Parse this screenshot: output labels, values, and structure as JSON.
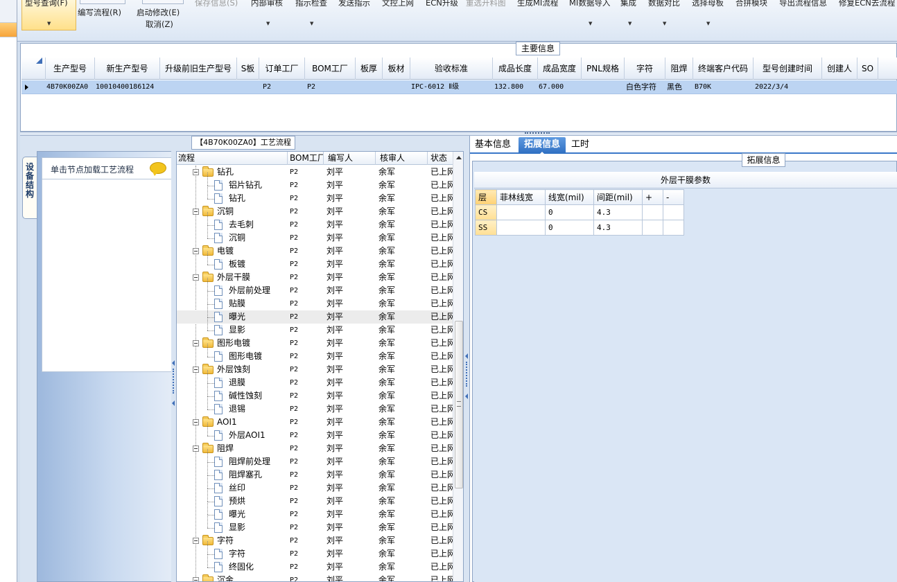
{
  "ribbon": {
    "query_model": "型号查询(F)",
    "write_flow": "编写流程(R)",
    "start_modify": "启动修改(E)",
    "cancel": "取消(Z)",
    "save_info": "保存信息(S)",
    "internal_review": "内部审核",
    "instruction_check": "指示检查",
    "send_instruction": "发送指示",
    "doc_upload": "文控上网",
    "ecn_upgrade": "ECN升级",
    "reselect_cutting": "重选开料图",
    "gen_mi_flow": "生成MI流程",
    "mi_data_import": "MI数据导入",
    "integrate": "集成",
    "data_compare": "数据对比",
    "select_mother": "选择母板",
    "merge_module": "合拼模块",
    "export_flow": "导出流程信息",
    "repair_ecn": "修复ECN去流程"
  },
  "main_info": {
    "title": "主要信息",
    "columns": [
      "生产型号",
      "新生产型号",
      "升级前旧生产型号",
      "S板",
      "订单工厂",
      "BOM工厂",
      "板厚",
      "板材",
      "验收标准",
      "成品长度",
      "成品宽度",
      "PNL规格",
      "字符",
      "阻焊",
      "终端客户代码",
      "型号创建时间",
      "创建人",
      "SO"
    ],
    "row": {
      "prod_model": "4B70K00ZA0",
      "new_model": "10010400186124",
      "old_model": "",
      "s_board": "",
      "order_factory": "P2",
      "bom_factory": "P2",
      "thickness": "",
      "material": "",
      "standard": "IPC-6012 Ⅱ级",
      "length": "132.800",
      "width": "67.000",
      "pnl": "",
      "character": "白色字符",
      "solder_mask": "黑色",
      "customer_code": "B70K",
      "created": "2022/3/4",
      "creator": "",
      "so": ""
    }
  },
  "process": {
    "title": "【4B70K00ZA0】工艺流程",
    "side_tab": "设备结构",
    "equip_hint": "单击节点加载工艺流程",
    "columns": [
      "流程",
      "BOM工厂",
      "编写人",
      "核审人",
      "状态"
    ],
    "rows": [
      {
        "name": "钻孔",
        "type": "folder",
        "bom": "P2",
        "writer": "刘平",
        "reviewer": "余军",
        "status": "已上网"
      },
      {
        "name": "铝片钻孔",
        "type": "leaf",
        "bom": "P2",
        "writer": "刘平",
        "reviewer": "余军",
        "status": "已上网"
      },
      {
        "name": "钻孔",
        "type": "leaf",
        "bom": "P2",
        "writer": "刘平",
        "reviewer": "余军",
        "status": "已上网"
      },
      {
        "name": "沉铜",
        "type": "folder",
        "bom": "P2",
        "writer": "刘平",
        "reviewer": "余军",
        "status": "已上网"
      },
      {
        "name": "去毛刺",
        "type": "leaf",
        "bom": "P2",
        "writer": "刘平",
        "reviewer": "余军",
        "status": "已上网"
      },
      {
        "name": "沉铜",
        "type": "leaf",
        "bom": "P2",
        "writer": "刘平",
        "reviewer": "余军",
        "status": "已上网"
      },
      {
        "name": "电镀",
        "type": "folder",
        "bom": "P2",
        "writer": "刘平",
        "reviewer": "余军",
        "status": "已上网"
      },
      {
        "name": "板镀",
        "type": "leaf",
        "bom": "P2",
        "writer": "刘平",
        "reviewer": "余军",
        "status": "已上网"
      },
      {
        "name": "外层干膜",
        "type": "folder",
        "bom": "P2",
        "writer": "刘平",
        "reviewer": "余军",
        "status": "已上网"
      },
      {
        "name": "外层前处理",
        "type": "leaf",
        "bom": "P2",
        "writer": "刘平",
        "reviewer": "余军",
        "status": "已上网"
      },
      {
        "name": "贴膜",
        "type": "leaf",
        "bom": "P2",
        "writer": "刘平",
        "reviewer": "余军",
        "status": "已上网"
      },
      {
        "name": "曝光",
        "type": "leaf",
        "bom": "P2",
        "writer": "刘平",
        "reviewer": "余军",
        "status": "已上网",
        "selected": true
      },
      {
        "name": "显影",
        "type": "leaf",
        "bom": "P2",
        "writer": "刘平",
        "reviewer": "余军",
        "status": "已上网"
      },
      {
        "name": "图形电镀",
        "type": "folder",
        "bom": "P2",
        "writer": "刘平",
        "reviewer": "余军",
        "status": "已上网"
      },
      {
        "name": "图形电镀",
        "type": "leaf",
        "bom": "P2",
        "writer": "刘平",
        "reviewer": "余军",
        "status": "已上网"
      },
      {
        "name": "外层蚀刻",
        "type": "folder",
        "bom": "P2",
        "writer": "刘平",
        "reviewer": "余军",
        "status": "已上网"
      },
      {
        "name": "退膜",
        "type": "leaf",
        "bom": "P2",
        "writer": "刘平",
        "reviewer": "余军",
        "status": "已上网"
      },
      {
        "name": "碱性蚀刻",
        "type": "leaf",
        "bom": "P2",
        "writer": "刘平",
        "reviewer": "余军",
        "status": "已上网"
      },
      {
        "name": "退锡",
        "type": "leaf",
        "bom": "P2",
        "writer": "刘平",
        "reviewer": "余军",
        "status": "已上网"
      },
      {
        "name": "AOI1",
        "type": "folder",
        "bom": "P2",
        "writer": "刘平",
        "reviewer": "余军",
        "status": "已上网"
      },
      {
        "name": "外层AOI1",
        "type": "leaf",
        "bom": "P2",
        "writer": "刘平",
        "reviewer": "余军",
        "status": "已上网"
      },
      {
        "name": "阻焊",
        "type": "folder",
        "bom": "P2",
        "writer": "刘平",
        "reviewer": "余军",
        "status": "已上网"
      },
      {
        "name": "阻焊前处理",
        "type": "leaf",
        "bom": "P2",
        "writer": "刘平",
        "reviewer": "余军",
        "status": "已上网"
      },
      {
        "name": "阻焊塞孔",
        "type": "leaf",
        "bom": "P2",
        "writer": "刘平",
        "reviewer": "余军",
        "status": "已上网"
      },
      {
        "name": "丝印",
        "type": "leaf",
        "bom": "P2",
        "writer": "刘平",
        "reviewer": "余军",
        "status": "已上网"
      },
      {
        "name": "预烘",
        "type": "leaf",
        "bom": "P2",
        "writer": "刘平",
        "reviewer": "余军",
        "status": "已上网"
      },
      {
        "name": "曝光",
        "type": "leaf",
        "bom": "P2",
        "writer": "刘平",
        "reviewer": "余军",
        "status": "已上网"
      },
      {
        "name": "显影",
        "type": "leaf",
        "bom": "P2",
        "writer": "刘平",
        "reviewer": "余军",
        "status": "已上网"
      },
      {
        "name": "字符",
        "type": "folder",
        "bom": "P2",
        "writer": "刘平",
        "reviewer": "余军",
        "status": "已上网"
      },
      {
        "name": "字符",
        "type": "leaf",
        "bom": "P2",
        "writer": "刘平",
        "reviewer": "余军",
        "status": "已上网"
      },
      {
        "name": "终固化",
        "type": "leaf",
        "bom": "P2",
        "writer": "刘平",
        "reviewer": "余军",
        "status": "已上网"
      },
      {
        "name": "沉金",
        "type": "folder",
        "bom": "P2",
        "writer": "刘平",
        "reviewer": "余军",
        "status": "已上网"
      }
    ]
  },
  "right_panel": {
    "tabs": [
      "基本信息",
      "拓展信息",
      "工时"
    ],
    "active_tab": "拓展信息",
    "ext_title": "拓展信息",
    "film_title": "外层干膜参数",
    "film_columns": [
      "层",
      "菲林线宽",
      "线宽(mil)",
      "间距(mil)",
      "+",
      "-"
    ],
    "film_rows": [
      {
        "layer": "CS",
        "film_width": "",
        "line_width": "0",
        "spacing": "4.3",
        "plus": "",
        "minus": ""
      },
      {
        "layer": "SS",
        "film_width": "",
        "line_width": "0",
        "spacing": "4.3",
        "plus": "",
        "minus": ""
      }
    ]
  },
  "colors": {
    "accent_blue": "#3a78c9",
    "selected_row": "#bcd4f2",
    "ribbon_highlight": "#ffe08a",
    "folder_yellow": "#f0b93a"
  }
}
